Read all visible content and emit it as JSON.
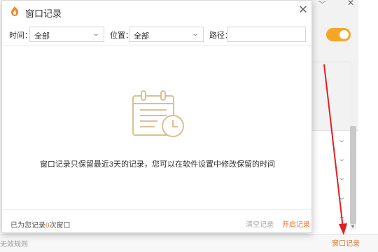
{
  "dialog": {
    "title": "窗口记录",
    "close_icon": "close-icon"
  },
  "filters": {
    "time_label": "时间：",
    "time_value": "全部",
    "position_label": "位置：",
    "position_value": "全部",
    "path_label": "路径：",
    "path_value": ""
  },
  "empty_state": {
    "icon": "calendar-clock-icon",
    "message": "窗口记录只保留最近3天的记录，您可以在软件设置中修改保留的时间"
  },
  "footer": {
    "status_prefix": "已为您记录",
    "status_count": "0",
    "status_suffix": "次窗口",
    "clear_label": "清空记录",
    "open_label": "开启记录"
  },
  "background": {
    "window_record_link": "窗口记录",
    "invalid_rules_text": "无效规则",
    "toggle_on": true
  },
  "colors": {
    "accent": "#e8772e",
    "toggle": "#f5a623",
    "arrow": "#e02020"
  }
}
